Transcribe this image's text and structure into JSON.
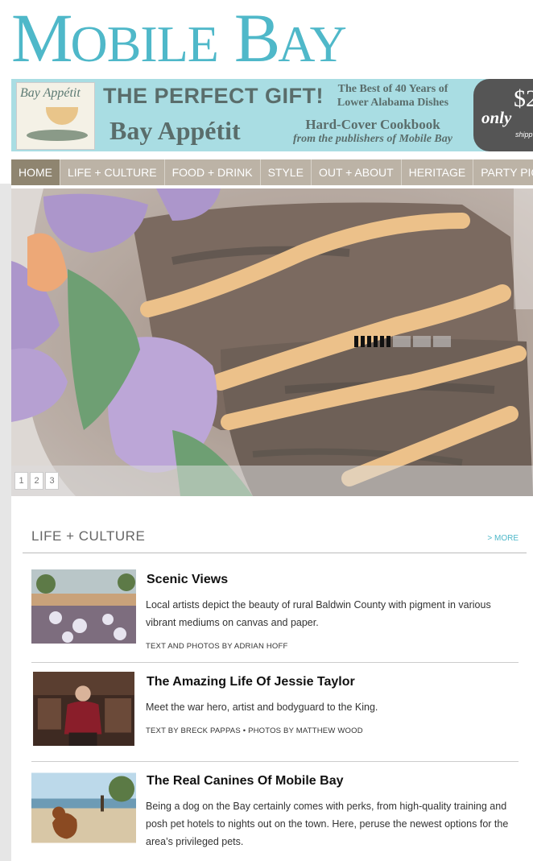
{
  "logo": {
    "text_m": "M",
    "text_obile": "OBILE",
    "text_b": "B",
    "text_ay": "AY"
  },
  "ad": {
    "book_script": "Bay Appétit",
    "headline": "THE PERFECT GIFT!",
    "product_name": "Bay Appétit",
    "best_line1": "The Best of 40 Years of",
    "best_line2": "Lower Alabama Dishes",
    "hard_line1": "Hard-Cover Cookbook",
    "hard_line2": "from the publishers of Mobile Bay",
    "price_only": "only",
    "price_num": "$2",
    "price_ship": "shipp"
  },
  "nav": {
    "items": [
      {
        "label": "HOME"
      },
      {
        "label": "LIFE + CULTURE"
      },
      {
        "label": "FOOD + DRINK"
      },
      {
        "label": "STYLE"
      },
      {
        "label": "OUT + ABOUT"
      },
      {
        "label": "HERITAGE"
      },
      {
        "label": "PARTY PICS"
      }
    ]
  },
  "slider": {
    "pages": [
      "1",
      "2",
      "3"
    ]
  },
  "section": {
    "title": "LIFE + CULTURE",
    "more": "> MORE"
  },
  "articles": [
    {
      "title": "Scenic Views",
      "desc": "Local artists depict the beauty of rural Baldwin County with pigment in various vibrant mediums on canvas and paper.",
      "byline": "TEXT AND PHOTOS BY ADRIAN HOFF"
    },
    {
      "title": "The Amazing Life Of Jessie Taylor",
      "desc": "Meet the war hero, artist and bodyguard to the King.",
      "byline": "TEXT BY BRECK PAPPAS • PHOTOS BY MATTHEW WOOD"
    },
    {
      "title": "The Real Canines Of Mobile Bay",
      "desc": "Being a dog on the Bay certainly comes with perks, from high-quality training and posh pet hotels to nights out on the town. Here, peruse the newest options for the area’s privileged pets."
    }
  ]
}
